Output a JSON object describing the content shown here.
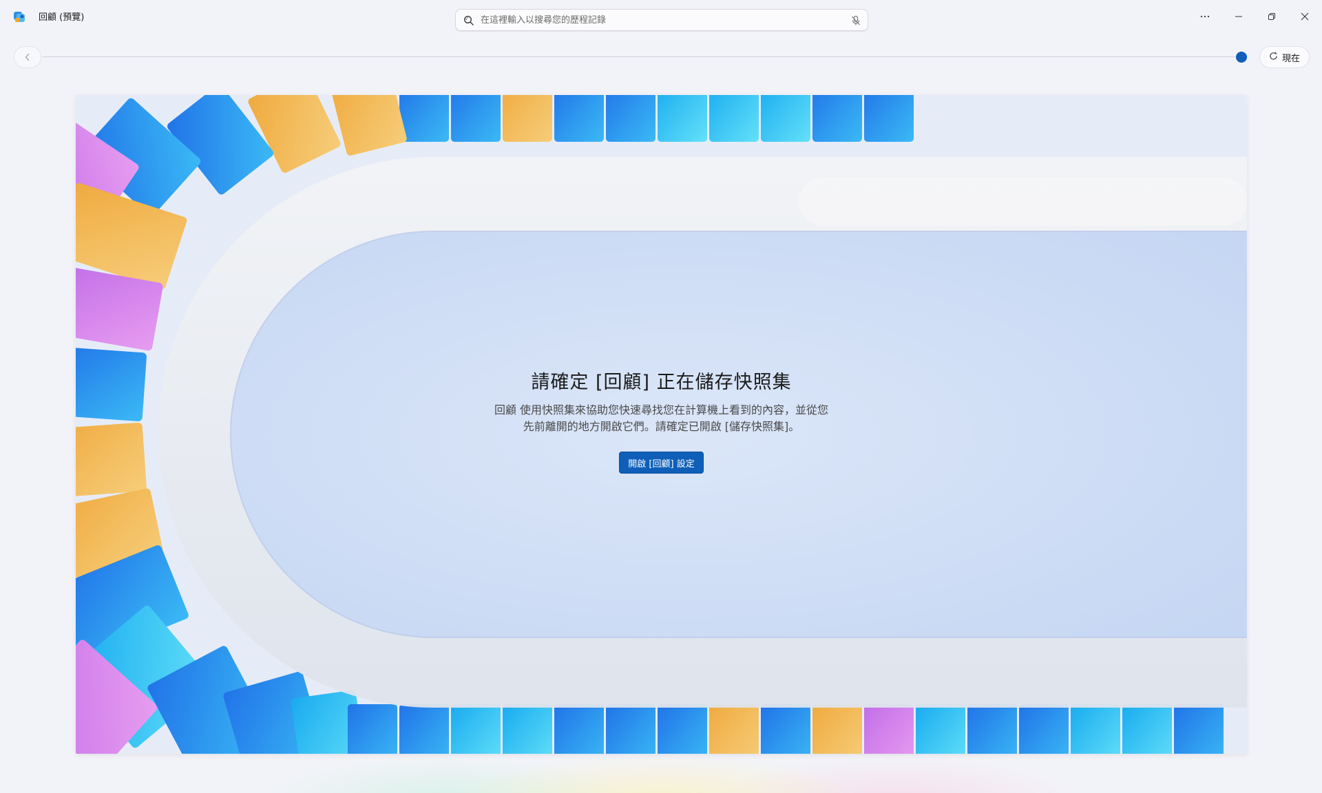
{
  "app": {
    "title": "回顧 (預覽)",
    "icon": "recall-app-icon"
  },
  "search": {
    "placeholder": "在這裡輸入以搜尋您的歷程記錄",
    "value": "",
    "icon": "search-icon",
    "mic_icon": "microphone-off-icon"
  },
  "window_controls": {
    "more": "more-icon",
    "minimize": "minimize-icon",
    "restore": "restore-icon",
    "close": "close-icon"
  },
  "timeline": {
    "back_icon": "chevron-left-icon",
    "now_label": "現在",
    "now_icon": "refresh-icon"
  },
  "hero": {
    "title": "請確定 [回顧] 正在儲存快照集",
    "description": "回顧 使用快照集來協助您快速尋找您在計算機上看到的內容，並從您先前離開的地方開啟它們。請確定已開啟 [儲存快照集]。",
    "button_label": "開啟 [回顧] 設定"
  },
  "colors": {
    "accent": "#0f5fb8",
    "background": "#f2f3f8"
  }
}
